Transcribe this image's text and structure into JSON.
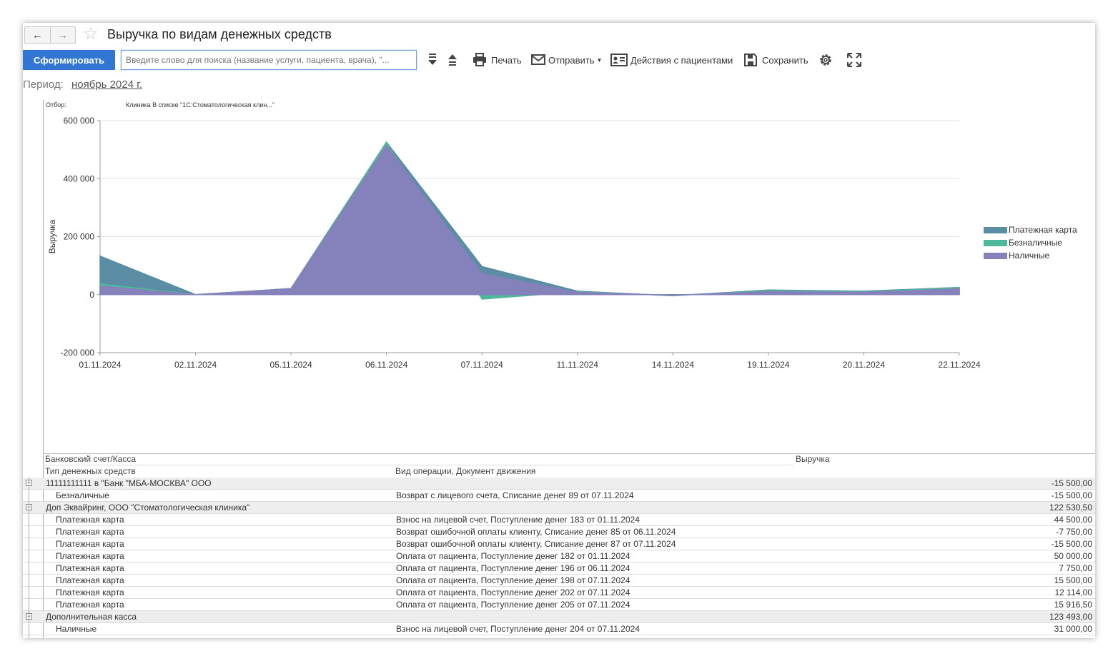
{
  "window": {
    "title": "Выручка по видам денежных средств",
    "back_icon": "arrow-left-icon",
    "forward_icon": "arrow-right-icon",
    "favorite_icon": "star-icon"
  },
  "toolbar": {
    "generate_label": "Сформировать",
    "search_placeholder": "Введите слово для поиска (название услуги, пациента, врача), \"...",
    "print_label": "Печать",
    "send_label": "Отправить",
    "patients_label": "Действия с пациентами",
    "save_label": "Сохранить"
  },
  "period": {
    "label": "Период:",
    "value": "ноябрь 2024 г."
  },
  "filter": {
    "label": "Отбор:",
    "value": "Клиника В списке \"1С:Стоматологическая клин...\""
  },
  "chart_data": {
    "type": "area",
    "ylabel": "Выручка",
    "ylim": [
      -200000,
      600000
    ],
    "yticks": [
      "600 000",
      "400 000",
      "200 000",
      "0",
      "-200 000"
    ],
    "ytick_values": [
      600000,
      400000,
      200000,
      0,
      -200000
    ],
    "x": [
      "01.11.2024",
      "02.11.2024",
      "05.11.2024",
      "06.11.2024",
      "07.11.2024",
      "11.11.2024",
      "14.11.2024",
      "19.11.2024",
      "20.11.2024",
      "22.11.2024"
    ],
    "legend_position": "right",
    "series": [
      {
        "name": "Платежная карта",
        "color": "#5b8ea5",
        "values": [
          133000,
          0,
          21000,
          526000,
          97000,
          12000,
          -4000,
          16000,
          12000,
          25000
        ]
      },
      {
        "name": "Безналичные",
        "color": "#4db89a",
        "values": [
          37000,
          0,
          21000,
          526000,
          -15500,
          10000,
          -3000,
          13000,
          10000,
          24000
        ]
      },
      {
        "name": "Наличные",
        "color": "#8581ba",
        "values": [
          30000,
          0,
          21000,
          515000,
          72000,
          8000,
          -2000,
          10000,
          8000,
          20000
        ]
      }
    ]
  },
  "table": {
    "header": {
      "col1": "Банковский счет/Касса",
      "col1b": "Тип денежных средств",
      "col2": "Вид операции, Документ движения",
      "col3": "Выручка"
    },
    "rows": [
      {
        "kind": "group",
        "c1": "11111111111 в \"Банк \"МБА-МОСКВА\" ООО",
        "c2": "",
        "c3": "-15 500,00"
      },
      {
        "kind": "item",
        "c1": "Безналичные",
        "c2": "Возврат с лицевого счета, Списание денег 89 от 07.11.2024",
        "c3": "-15 500,00"
      },
      {
        "kind": "group",
        "c1": "Доп Эквайринг, ООО \"Стоматологическая клиника\"",
        "c2": "",
        "c3": "122 530,50"
      },
      {
        "kind": "item",
        "c1": "Платежная карта",
        "c2": "Взнос на лицевой счет, Поступление денег 183 от 01.11.2024",
        "c3": "44 500,00"
      },
      {
        "kind": "item",
        "c1": "Платежная карта",
        "c2": "Возврат ошибочной оплаты клиенту, Списание денег 85 от 06.11.2024",
        "c3": "-7 750,00"
      },
      {
        "kind": "item",
        "c1": "Платежная карта",
        "c2": "Возврат ошибочной оплаты клиенту, Списание денег 87 от 07.11.2024",
        "c3": "-15 500,00"
      },
      {
        "kind": "item",
        "c1": "Платежная карта",
        "c2": "Оплата от пациента, Поступление денег 182 от 01.11.2024",
        "c3": "50 000,00"
      },
      {
        "kind": "item",
        "c1": "Платежная карта",
        "c2": "Оплата от пациента, Поступление денег 196 от 06.11.2024",
        "c3": "7 750,00"
      },
      {
        "kind": "item",
        "c1": "Платежная карта",
        "c2": "Оплата от пациента, Поступление денег 198 от 07.11.2024",
        "c3": "15 500,00"
      },
      {
        "kind": "item",
        "c1": "Платежная карта",
        "c2": "Оплата от пациента, Поступление денег 202 от 07.11.2024",
        "c3": "12 114,00"
      },
      {
        "kind": "item",
        "c1": "Платежная карта",
        "c2": "Оплата от пациента, Поступление денег 205 от 07.11.2024",
        "c3": "15 916,50"
      },
      {
        "kind": "group",
        "c1": "Дополнительная касса",
        "c2": "",
        "c3": "123 493,00"
      },
      {
        "kind": "item",
        "c1": "Наличные",
        "c2": "Взнос на лицевой счет, Поступление денег 204 от 07.11.2024",
        "c3": "31 000,00"
      }
    ]
  }
}
